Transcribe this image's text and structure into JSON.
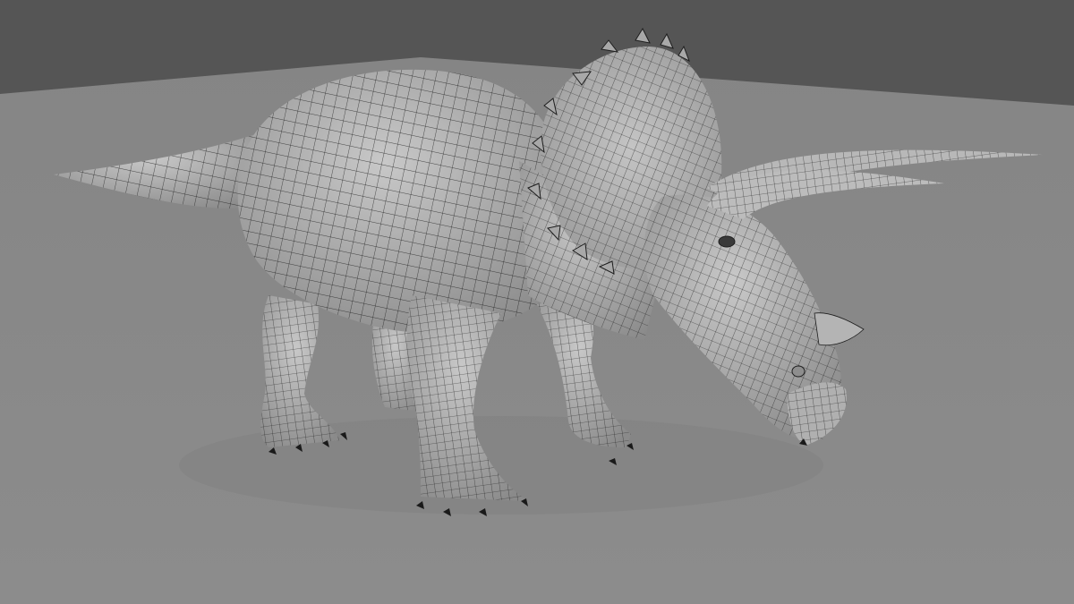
{
  "scene": {
    "subject": "triceratops-wireframe-mesh",
    "colors": {
      "background": "#555555",
      "ground": "#8c8c8c",
      "ground_far": "#858585",
      "mesh_fill": "#b6b6b6",
      "mesh_light": "#c8c8c8",
      "mesh_dark": "#8a8a8a",
      "wire": "#1e1e1e",
      "claw": "#1a1a1a"
    }
  }
}
